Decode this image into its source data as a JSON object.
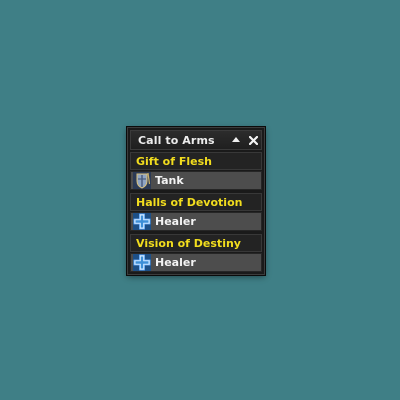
{
  "window": {
    "title": "Call to Arms",
    "collapse_glyph": "▲",
    "close_glyph": "✕"
  },
  "entries": [
    {
      "dungeon": "Gift of Flesh",
      "role": "Tank",
      "role_icon": "shield-icon"
    },
    {
      "dungeon": "Halls of Devotion",
      "role": "Healer",
      "role_icon": "cross-icon"
    },
    {
      "dungeon": "Vision of Destiny",
      "role": "Healer",
      "role_icon": "cross-icon"
    }
  ],
  "colors": {
    "background": "#3f7f86",
    "dungeon_name": "#f2dd1e",
    "role_row": "#4d4d4d",
    "healer_cross": "#3d8fd8"
  }
}
